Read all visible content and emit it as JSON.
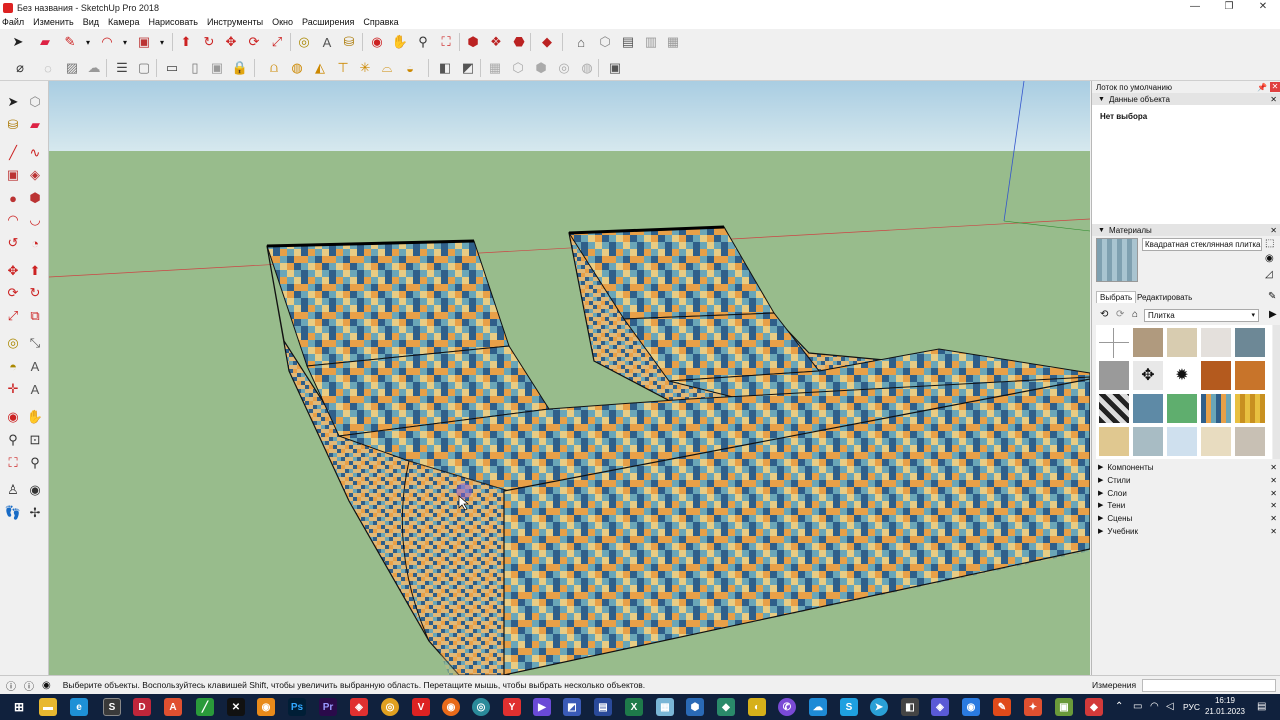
{
  "window": {
    "title": "Без названия - SketchUp Pro 2018"
  },
  "menu": [
    "Файл",
    "Изменить",
    "Вид",
    "Камера",
    "Нарисовать",
    "Инструменты",
    "Окно",
    "Расширения",
    "Справка"
  ],
  "tray": {
    "title": "Лоток по умолчанию",
    "entity_info": {
      "header": "Данные объекта",
      "no_selection": "Нет выбора"
    },
    "materials": {
      "header": "Материалы",
      "current_material": "Квадратная стеклянная плитка 0",
      "tab_select": "Выбрать",
      "tab_edit": "Редактировать",
      "library": "Плитка"
    },
    "collapsed_panels": [
      "Компоненты",
      "Стили",
      "Слои",
      "Тени",
      "Сцены",
      "Учебник"
    ]
  },
  "status": {
    "hint": "Выберите объекты. Воспользуйтесь клавишей Shift, чтобы увеличить выбранную область. Перетащите мышь, чтобы выбрать несколько объектов.",
    "measurements_label": "Измерения"
  },
  "taskbar": {
    "lang": "РУС",
    "time": "16:19",
    "date": "21.01.2023"
  },
  "colors": {
    "sky": "#bcd7e4",
    "ground": "#98bc8c",
    "tile_orange": "#e8a048",
    "tile_blue": "#2f5f8a",
    "tile_teal": "#6aa6b8",
    "tile_sand": "#e8cc84",
    "taskbar": "#10213d"
  }
}
